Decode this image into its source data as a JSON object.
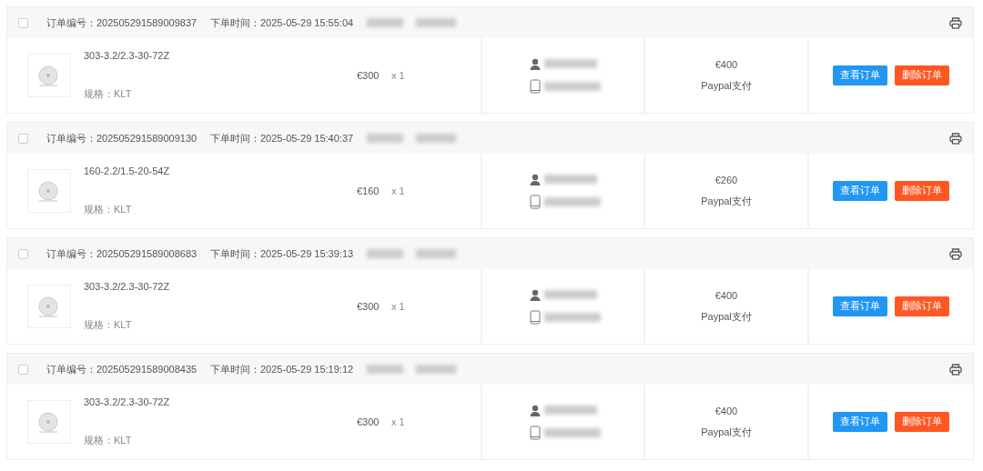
{
  "orders": [
    {
      "checked": false,
      "order_no": "订单编号：202505291589009837",
      "order_time": "下单时间：2025-05-29 15:55:04",
      "product": {
        "name": "303-3.2/2.3-30-72Z",
        "spec": "规格：KLT",
        "price": "€300",
        "qty": "x 1"
      },
      "total": "€400",
      "payment": "Paypal支付",
      "buttons": [
        "查看订单",
        "删除订单"
      ]
    },
    {
      "checked": false,
      "order_no": "订单编号：202505291589009130",
      "order_time": "下单时间：2025-05-29 15:40:37",
      "product": {
        "name": "160-2.2/1.5-20-54Z",
        "spec": "规格：KLT",
        "price": "€160",
        "qty": "x 1"
      },
      "total": "€260",
      "payment": "Paypal支付",
      "buttons": [
        "查看订单",
        "删除订单"
      ]
    },
    {
      "checked": false,
      "order_no": "订单编号：202505291589008683",
      "order_time": "下单时间：2025-05-29 15:39:13",
      "product": {
        "name": "303-3.2/2.3-30-72Z",
        "spec": "规格：KLT",
        "price": "€300",
        "qty": "x 1"
      },
      "total": "€400",
      "payment": "Paypal支付",
      "buttons": [
        "查看订单",
        "删除订单"
      ]
    },
    {
      "checked": false,
      "order_no": "订单编号：202505291589008435",
      "order_time": "下单时间：2025-05-29 15:19:12",
      "product": {
        "name": "303-3.2/2.3-30-72Z",
        "spec": "规格：KLT",
        "price": "€300",
        "qty": "x 1"
      },
      "total": "€400",
      "payment": "Paypal支付",
      "buttons": [
        "查看订单",
        "删除订单"
      ]
    }
  ]
}
